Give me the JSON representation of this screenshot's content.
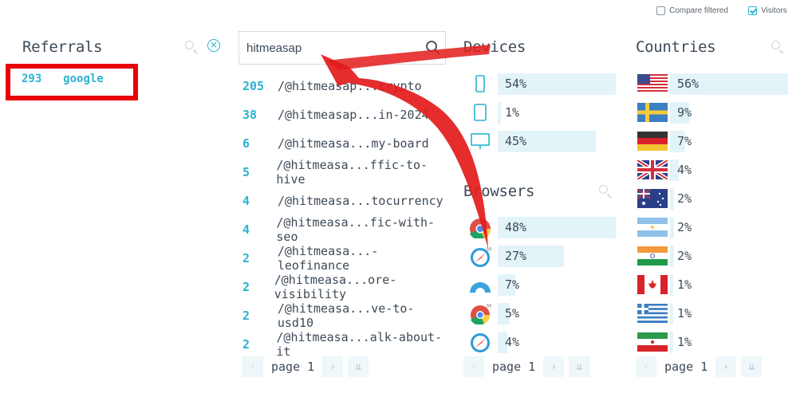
{
  "options": {
    "compare_filtered": "Compare filtered",
    "visitors": "Visitors"
  },
  "referrals": {
    "title": "Referrals",
    "items": [
      {
        "count": "293",
        "name": "google"
      }
    ]
  },
  "pages": {
    "search_value": "hitmeasap",
    "items": [
      {
        "count": "205",
        "path": "/@hitmeasap...crypto"
      },
      {
        "count": "38",
        "path": "/@hitmeasap...in-2024"
      },
      {
        "count": "6",
        "path": "/@hitmeasa...my-board"
      },
      {
        "count": "5",
        "path": "/@hitmeasa...ffic-to-hive"
      },
      {
        "count": "4",
        "path": "/@hitmeasa...tocurrency"
      },
      {
        "count": "4",
        "path": "/@hitmeasa...fic-with-seo"
      },
      {
        "count": "2",
        "path": "/@hitmeasa...-leofinance"
      },
      {
        "count": "2",
        "path": "/@hitmeasa...ore-visibility"
      },
      {
        "count": "2",
        "path": "/@hitmeasa...ve-to-usd10"
      },
      {
        "count": "2",
        "path": "/@hitmeasa...alk-about-it"
      }
    ],
    "page_label": "page 1"
  },
  "devices": {
    "title": "Devices",
    "items": [
      {
        "icon": "mobile-icon",
        "pct": "54%",
        "value": 54
      },
      {
        "icon": "tablet-icon",
        "pct": "1%",
        "value": 1
      },
      {
        "icon": "desktop-icon",
        "pct": "45%",
        "value": 45
      }
    ]
  },
  "browsers": {
    "title": "Browsers",
    "items": [
      {
        "icon": "chrome-icon",
        "pct": "48%",
        "value": 48
      },
      {
        "icon": "safari-mobile-icon",
        "pct": "27%",
        "value": 27
      },
      {
        "icon": "gauge-browser-icon",
        "pct": "7%",
        "value": 7
      },
      {
        "icon": "chrome-mobile-icon",
        "pct": "5%",
        "value": 5
      },
      {
        "icon": "safari-icon",
        "pct": "4%",
        "value": 4
      }
    ],
    "page_label": "page 1"
  },
  "countries": {
    "title": "Countries",
    "items": [
      {
        "icon": "flag-us-icon",
        "pct": "56%",
        "value": 56
      },
      {
        "icon": "flag-se-icon",
        "pct": "9%",
        "value": 9
      },
      {
        "icon": "flag-de-icon",
        "pct": "7%",
        "value": 7
      },
      {
        "icon": "flag-gb-icon",
        "pct": "4%",
        "value": 4
      },
      {
        "icon": "flag-au-icon",
        "pct": "2%",
        "value": 2
      },
      {
        "icon": "flag-ar-icon",
        "pct": "2%",
        "value": 2
      },
      {
        "icon": "flag-in-icon",
        "pct": "2%",
        "value": 2
      },
      {
        "icon": "flag-ca-icon",
        "pct": "1%",
        "value": 1
      },
      {
        "icon": "flag-gr-icon",
        "pct": "1%",
        "value": 1
      },
      {
        "icon": "flag-ir-icon",
        "pct": "1%",
        "value": 1
      }
    ],
    "page_label": "page 1"
  },
  "colors": {
    "accent": "#2bb3d0",
    "bar": "#e3f4f9",
    "highlight": "#e8000b",
    "text": "#3d4a57"
  }
}
